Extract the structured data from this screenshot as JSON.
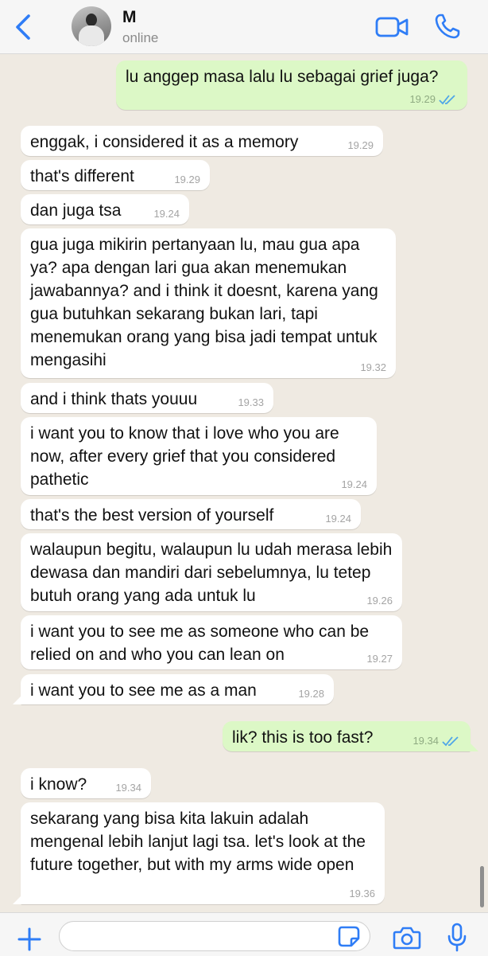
{
  "header": {
    "contact_name": "M",
    "status": "online",
    "accent_color": "#2f7df6"
  },
  "messages": [
    {
      "side": "out",
      "text": "lu anggep masa lalu lu sebagai grief juga?",
      "time": "19.29",
      "read": true
    },
    {
      "side": "in",
      "text": "enggak, i considered it as a memory",
      "time": "19.29"
    },
    {
      "side": "in",
      "text": "that's different",
      "time": "19.29"
    },
    {
      "side": "in",
      "text": "dan juga tsa",
      "time": "19.24"
    },
    {
      "side": "in",
      "text": "gua juga mikirin pertanyaan lu, mau gua apa ya? apa dengan lari gua akan menemukan jawabannya? and i think it doesnt, karena yang gua butuhkan sekarang bukan lari, tapi menemukan orang yang bisa jadi tempat untuk mengasihi",
      "time": "19.32"
    },
    {
      "side": "in",
      "text": "and i think thats youuu",
      "time": "19.33"
    },
    {
      "side": "in",
      "text": "i want you to know that i love who you are now, after every grief that you considered pathetic",
      "time": "19.24"
    },
    {
      "side": "in",
      "text": "that's the best version of yourself",
      "time": "19.24"
    },
    {
      "side": "in",
      "text": "walaupun begitu, walaupun lu udah merasa lebih dewasa dan mandiri dari sebelumnya, lu tetep butuh orang yang ada untuk lu",
      "time": "19.26"
    },
    {
      "side": "in",
      "text": "i want you to see me as someone who can be relied on and who you can lean on",
      "time": "19.27"
    },
    {
      "side": "in",
      "text": "i want you to see me as a man",
      "time": "19.28"
    },
    {
      "side": "out",
      "text": "lik? this is too fast?",
      "time": "19.34",
      "read": true
    },
    {
      "side": "in",
      "text": "i know?",
      "time": "19.34"
    },
    {
      "side": "in",
      "text": "sekarang yang bisa kita lakuin adalah mengenal lebih lanjut lagi tsa. let's look at the future together, but with my arms wide open",
      "time": "19.36"
    }
  ],
  "input": {
    "value": "",
    "placeholder": ""
  },
  "icons": {
    "back": "chevron-left-icon",
    "video": "video-camera-icon",
    "call": "phone-icon",
    "plus": "plus-icon",
    "sticker": "sticker-icon",
    "camera": "camera-icon",
    "mic": "microphone-icon"
  },
  "colors": {
    "chat_background": "#efeae2",
    "outgoing_bubble": "#dcf8c6",
    "incoming_bubble": "#ffffff",
    "read_ticks": "#4fa6e8"
  }
}
